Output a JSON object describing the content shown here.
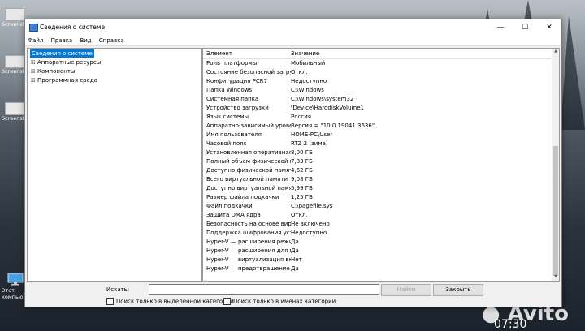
{
  "desktop": {
    "icons": [
      {
        "label": "Screensho"
      },
      {
        "label": "Screensho"
      },
      {
        "label": "Screensho"
      },
      {
        "label": "Этот компьютер"
      }
    ],
    "watermark": "Avito",
    "clock": "07:30"
  },
  "window": {
    "title": "Сведения о системе",
    "menu": [
      "Файл",
      "Правка",
      "Вид",
      "Справка"
    ],
    "tree": {
      "root": "Сведения о системе",
      "items": [
        "Аппаратные ресурсы",
        "Компоненты",
        "Программная среда"
      ]
    },
    "list": {
      "headers": {
        "element": "Элемент",
        "value": "Значение"
      },
      "rows": [
        {
          "name": "Роль платформы",
          "value": "Мобильный"
        },
        {
          "name": "Состояние безопасной загрузки",
          "value": "Откл."
        },
        {
          "name": "Конфигурация PCR7",
          "value": "Недоступно"
        },
        {
          "name": "Папка Windows",
          "value": "C:\\Windows"
        },
        {
          "name": "Системная папка",
          "value": "C:\\Windows\\system32"
        },
        {
          "name": "Устройство загрузки",
          "value": "\\Device\\HarddiskVolume1"
        },
        {
          "name": "Язык системы",
          "value": "Россия"
        },
        {
          "name": "Аппаратно-зависимый уровень",
          "value": "Версия = \"10.0.19041.3636\""
        },
        {
          "name": "Имя пользователя",
          "value": "HOME-PC\\User"
        },
        {
          "name": "Часовой пояс",
          "value": "RTZ 2 (зима)"
        },
        {
          "name": "Установленная оперативная память",
          "value": "8,00 ГБ"
        },
        {
          "name": "Полный объем физической памяти",
          "value": "7,83 ГБ"
        },
        {
          "name": "Доступно физической памяти",
          "value": "4,62 ГБ"
        },
        {
          "name": "Всего виртуальной памяти",
          "value": "9,08 ГБ"
        },
        {
          "name": "Доступно виртуальной памяти",
          "value": "5,99 ГБ"
        },
        {
          "name": "Размер файла подкачки",
          "value": "1,25 ГБ"
        },
        {
          "name": "Файл подкачки",
          "value": "C:\\pagefile.sys"
        },
        {
          "name": "Защита DMA ядра",
          "value": "Откл."
        },
        {
          "name": "Безопасность на основе виртуализации",
          "value": "Не включено"
        },
        {
          "name": "Поддержка шифрования устройства",
          "value": "Недоступно"
        },
        {
          "name": "Hyper-V — расширения режима мониторинга ВМ",
          "value": "Да"
        },
        {
          "name": "Hyper-V — расширения для преобразования адресов",
          "value": "Да"
        },
        {
          "name": "Hyper-V — виртуализация включена",
          "value": "Нет"
        },
        {
          "name": "Hyper-V — предотвращение выполнения данных",
          "value": "Да"
        }
      ]
    },
    "find": {
      "label": "Искать:",
      "value": "",
      "find_button": "Найти",
      "close_button": "Закрыть",
      "opt_category": "Поиск только в выделенной категории",
      "opt_names": "Поиск только в именах категорий"
    }
  }
}
